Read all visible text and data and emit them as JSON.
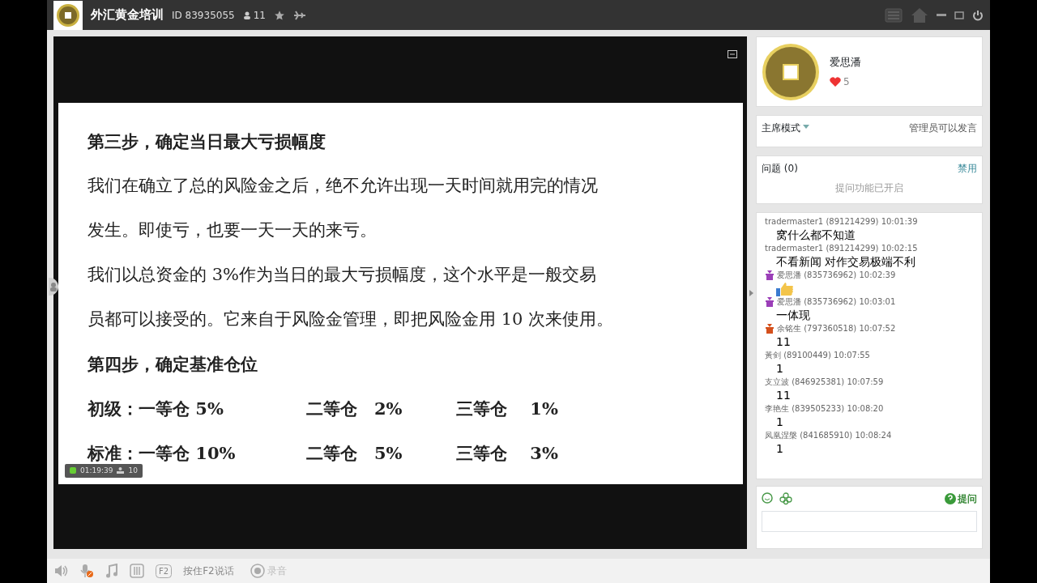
{
  "titlebar": {
    "room": "外汇黄金培训",
    "id": "ID 83935055",
    "members": "11"
  },
  "slide": {
    "heading1": "第三步，确定当日最大亏损幅度",
    "para1": [
      "我们在确立了总的风险金之后，绝不允许出现一天时间就用完的情况",
      "发生。即使亏，也要一天一天的来亏。"
    ],
    "para2": [
      "我们以总资金的 3%作为当日的最大亏损幅度，这个水平是一般交易",
      "员都可以接受的。它来自于风险金管理，即把风险金用 10 次来使用。"
    ],
    "heading2": "第四步，确定基准仓位",
    "table": [
      [
        "初级：一等仓 5%",
        "二等仓　2%",
        "三等仓　 1%"
      ],
      [
        "标准：一等仓 10%",
        "二等仓　5%",
        "三等仓　 3%"
      ]
    ]
  },
  "overlay": {
    "time": "01:19:39",
    "viewers": "10"
  },
  "host": {
    "name": "爱思潘",
    "likes": "5"
  },
  "mode": {
    "label": "主席模式",
    "rule": "管理员可以发言"
  },
  "questions": {
    "title": "问题 (0)",
    "action": "禁用",
    "status": "提问功能已开启"
  },
  "chat": [
    {
      "user": "tradermaster1",
      "meta": "(891214299) 10:01:39",
      "kind": "text",
      "text": "窝什么都不知道"
    },
    {
      "user": "tradermaster1",
      "meta": "(891214299) 10:02:15",
      "kind": "text",
      "text": "不看新闻  对作交易极端不利"
    },
    {
      "user": "爱思潘",
      "meta": "(835736962) 10:02:39",
      "color": "#9b3fb8",
      "kind": "emoji"
    },
    {
      "user": "爱思潘",
      "meta": "(835736962) 10:03:01",
      "color": "#9b3fb8",
      "kind": "text",
      "text": "一体现"
    },
    {
      "user": "余铭生",
      "meta": "(797360518) 10:07:52",
      "color": "#d4501c",
      "kind": "text",
      "text": "11"
    },
    {
      "user": "黃剑",
      "meta": "(89100449) 10:07:55",
      "kind": "text",
      "text": "1"
    },
    {
      "user": "支立波",
      "meta": "(846925381) 10:07:59",
      "kind": "text",
      "text": "11"
    },
    {
      "user": "李艳生",
      "meta": "(839505233) 10:08:20",
      "kind": "text",
      "text": "1"
    },
    {
      "user": "凤凰涅槃",
      "meta": "(841685910) 10:08:24",
      "kind": "text",
      "text": "1"
    }
  ],
  "composer": {
    "ask": "提问"
  },
  "toolbar": {
    "mic_muted": true,
    "key": "F2",
    "ptt": "按住F2说话",
    "record": {
      "label": "录音",
      "disabled": true
    }
  }
}
